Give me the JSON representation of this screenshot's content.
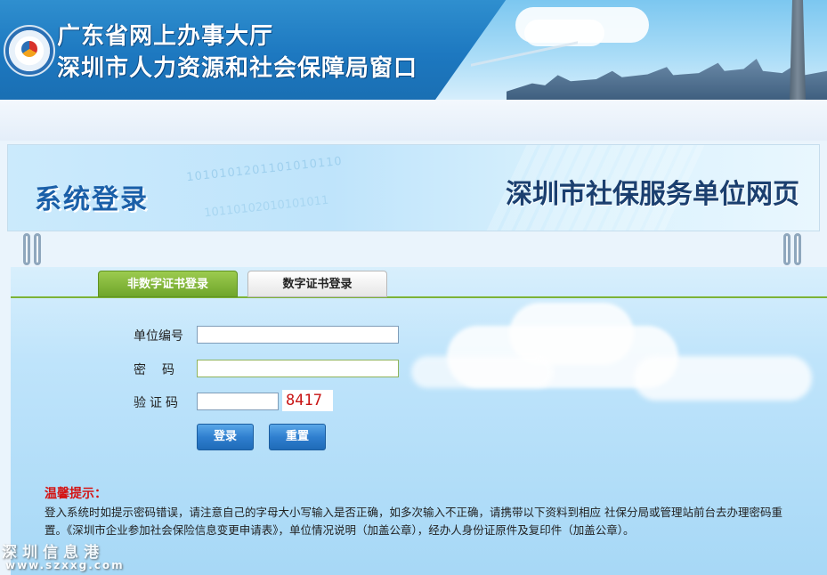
{
  "header": {
    "title_line1": "广东省网上办事大厅",
    "title_line2": "深圳市人力资源和社会保障局窗口"
  },
  "banner": {
    "left_title": "系统登录",
    "right_title": "深圳市社保服务",
    "right_title_highlight": "单位网页",
    "decor_digits_1": "1010101201101010110",
    "decor_digits_2": "10110102010101011"
  },
  "tabs": [
    {
      "label": "非数字证书登录",
      "active": true
    },
    {
      "label": "数字证书登录",
      "active": false
    }
  ],
  "form": {
    "unit_code_label": "单位编号",
    "unit_code_value": "",
    "password_label": "密码",
    "password_value": "",
    "captcha_label": "验证码",
    "captcha_value": "",
    "captcha_code": "8417",
    "login_button": "登录",
    "reset_button": "重置"
  },
  "tips": {
    "title": "温馨提示：",
    "text": "登入系统时如提示密码错误，请注意自己的字母大小写输入是否正确，如多次输入不正确，请携带以下资料到相应 社保分局或管理站前台去办理密码重置。《深圳市企业参加社会保险信息变更申请表》，单位情况说明（加盖公章），经办人身份证原件及复印件（加盖公章）。"
  },
  "watermark": {
    "line1": "深圳信息港",
    "line2": "www.szxxg.com"
  },
  "colors": {
    "header_blue": "#1d78c0",
    "tab_active_green": "#7db336",
    "tip_red": "#d41414",
    "captcha_red": "#c81414"
  }
}
